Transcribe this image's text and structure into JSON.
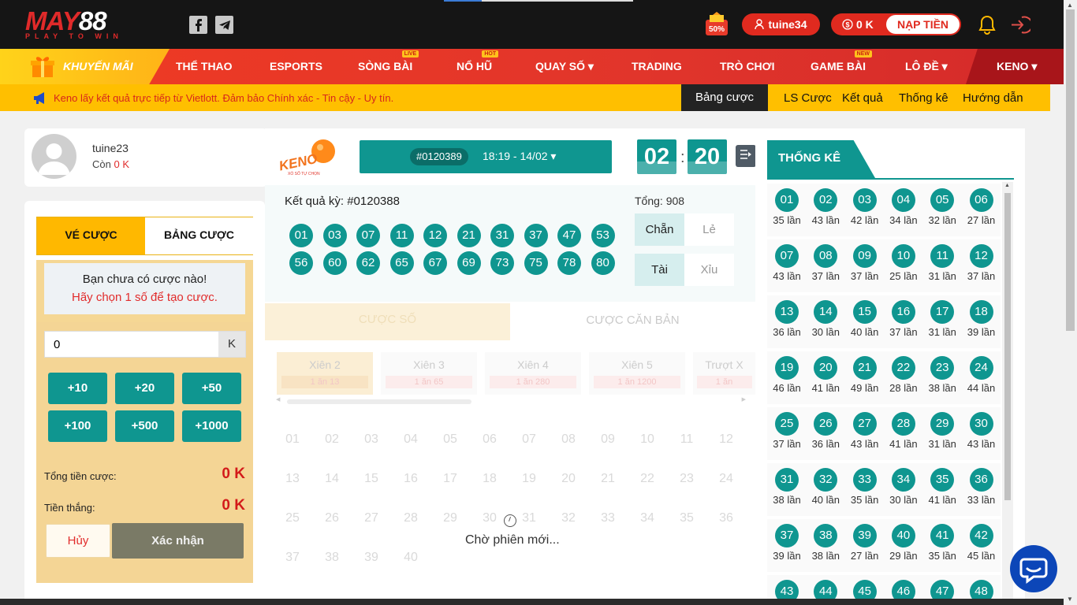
{
  "header": {
    "logo_main": "MAY88",
    "logo_tagline": "PLAY TO WIN",
    "social": [
      {
        "icon": "facebook-icon"
      },
      {
        "icon": "telegram-icon"
      }
    ],
    "promo_badge": "50%",
    "username": "tuine34",
    "balance": "0 K",
    "deposit_label": "NẠP TIỀN",
    "colors": {
      "bg": "#151515",
      "accent": "#e02a1f"
    }
  },
  "nav": {
    "promo_label": "KHUYẾN MÃI",
    "items": [
      {
        "label": "THỂ THAO",
        "tag": ""
      },
      {
        "label": "ESPORTS",
        "tag": ""
      },
      {
        "label": "SÒNG BÀI",
        "tag": "LIVE"
      },
      {
        "label": "NỔ HŨ",
        "tag": "HOT"
      },
      {
        "label": "QUAY SỐ ▾",
        "tag": ""
      },
      {
        "label": "TRADING",
        "tag": ""
      },
      {
        "label": "TRÒ CHƠI",
        "tag": ""
      },
      {
        "label": "GAME BÀI",
        "tag": "NEW"
      },
      {
        "label": "LÔ ĐỀ ▾",
        "tag": ""
      }
    ],
    "active_label": "KENO ▾"
  },
  "announce": {
    "text": "Keno lấy kết quả trực tiếp từ Vietlott. Đảm bảo Chính xác - Tin cậy - Uy tín.",
    "tabs": [
      "Bảng cược",
      "LS Cược",
      "Kết quả",
      "Thống kê",
      "Hướng dẫn"
    ]
  },
  "user": {
    "name": "tuine23",
    "balance_prefix": "Còn",
    "balance": "0 K"
  },
  "betslip": {
    "tab_active": "VÉ CƯỢC",
    "tab_other": "BẢNG CƯỢC",
    "empty_title": "Bạn chưa có cược nào!",
    "empty_hint": "Hãy chọn 1 số để tạo cược.",
    "amount_value": "0",
    "amount_unit": "K",
    "quick": [
      "+10",
      "+20",
      "+50",
      "+100",
      "+500",
      "+1000"
    ],
    "total_label": "Tổng tiền cược:",
    "total_value": "0 K",
    "win_label": "Tiền thắng:",
    "win_value": "0 K",
    "cancel": "Hủy",
    "confirm": "Xác nhận"
  },
  "game": {
    "logo": "KENO",
    "logo_sub": "XỔ SỐ TỰ CHỌN",
    "draw_id": "#0120389",
    "draw_time": "18:19 - 14/02 ▾",
    "countdown_min": "02",
    "countdown_sep": ":",
    "countdown_sec": "20",
    "result_label": "Kết quả kỳ: #0120388",
    "result_balls": [
      "01",
      "03",
      "07",
      "11",
      "12",
      "21",
      "31",
      "37",
      "47",
      "53",
      "56",
      "60",
      "62",
      "65",
      "67",
      "69",
      "73",
      "75",
      "78",
      "80"
    ],
    "total": "Tổng: 908",
    "chan": "Chẵn",
    "le": "Lẻ",
    "tai": "Tài",
    "xiu": "Xỉu",
    "tab_so": "CƯỢC SỐ",
    "tab_canban": "CƯỢC CĂN BẢN",
    "xien": [
      {
        "name": "Xiên 2",
        "odds": "1 ăn 13"
      },
      {
        "name": "Xiên 3",
        "odds": "1 ăn 65"
      },
      {
        "name": "Xiên 4",
        "odds": "1 ăn 280"
      },
      {
        "name": "Xiên 5",
        "odds": "1 ăn 1200"
      },
      {
        "name": "Trượt X",
        "odds": "1 ăn"
      }
    ],
    "grid": [
      "01",
      "02",
      "03",
      "04",
      "05",
      "06",
      "07",
      "08",
      "09",
      "10",
      "11",
      "12",
      "13",
      "14",
      "15",
      "16",
      "17",
      "18",
      "19",
      "20",
      "21",
      "22",
      "23",
      "24",
      "25",
      "26",
      "27",
      "28",
      "29",
      "30",
      "31",
      "32",
      "33",
      "34",
      "35",
      "36",
      "37",
      "38",
      "39",
      "40"
    ],
    "waiting": "Chờ phiên mới..."
  },
  "stats": {
    "title": "THỐNG KÊ",
    "rows": [
      [
        [
          "01",
          "35 lần"
        ],
        [
          "02",
          "43 lần"
        ],
        [
          "03",
          "42 lần"
        ],
        [
          "04",
          "34 lần"
        ],
        [
          "05",
          "32 lần"
        ],
        [
          "06",
          "27 lần"
        ]
      ],
      [
        [
          "07",
          "43 lần"
        ],
        [
          "08",
          "37 lần"
        ],
        [
          "09",
          "37 lần"
        ],
        [
          "10",
          "25 lần"
        ],
        [
          "11",
          "31 lần"
        ],
        [
          "12",
          "37 lần"
        ]
      ],
      [
        [
          "13",
          "36 lần"
        ],
        [
          "14",
          "30 lần"
        ],
        [
          "15",
          "40 lần"
        ],
        [
          "16",
          "37 lần"
        ],
        [
          "17",
          "31 lần"
        ],
        [
          "18",
          "39 lần"
        ]
      ],
      [
        [
          "19",
          "46 lần"
        ],
        [
          "20",
          "41 lần"
        ],
        [
          "21",
          "49 lần"
        ],
        [
          "22",
          "28 lần"
        ],
        [
          "23",
          "38 lần"
        ],
        [
          "24",
          "44 lần"
        ]
      ],
      [
        [
          "25",
          "37 lần"
        ],
        [
          "26",
          "36 lần"
        ],
        [
          "27",
          "43 lần"
        ],
        [
          "28",
          "41 lần"
        ],
        [
          "29",
          "31 lần"
        ],
        [
          "30",
          "43 lần"
        ]
      ],
      [
        [
          "31",
          "38 lần"
        ],
        [
          "32",
          "40 lần"
        ],
        [
          "33",
          "35 lần"
        ],
        [
          "34",
          "30 lần"
        ],
        [
          "35",
          "41 lần"
        ],
        [
          "36",
          "33 lần"
        ]
      ],
      [
        [
          "37",
          "39 lần"
        ],
        [
          "38",
          "38 lần"
        ],
        [
          "39",
          "27 lần"
        ],
        [
          "40",
          "29 lần"
        ],
        [
          "41",
          "35 lần"
        ],
        [
          "42",
          "45 lần"
        ]
      ],
      [
        [
          "43",
          ""
        ],
        [
          "44",
          ""
        ],
        [
          "45",
          ""
        ],
        [
          "46",
          ""
        ],
        [
          "47",
          ""
        ],
        [
          "48",
          ""
        ]
      ]
    ]
  }
}
